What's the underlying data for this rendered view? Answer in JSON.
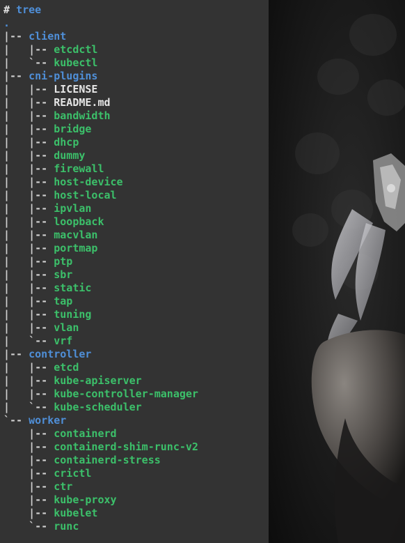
{
  "terminal": {
    "prompt_symbol": "#",
    "command": "tree",
    "root": ".",
    "lines": [
      {
        "prefix": "|-- ",
        "name": "client",
        "kind": "dir"
      },
      {
        "prefix": "|   |-- ",
        "name": "etcdctl",
        "kind": "exe"
      },
      {
        "prefix": "|   `-- ",
        "name": "kubectl",
        "kind": "exe"
      },
      {
        "prefix": "|-- ",
        "name": "cni-plugins",
        "kind": "dir"
      },
      {
        "prefix": "|   |-- ",
        "name": "LICENSE",
        "kind": "file"
      },
      {
        "prefix": "|   |-- ",
        "name": "README.md",
        "kind": "file"
      },
      {
        "prefix": "|   |-- ",
        "name": "bandwidth",
        "kind": "exe"
      },
      {
        "prefix": "|   |-- ",
        "name": "bridge",
        "kind": "exe"
      },
      {
        "prefix": "|   |-- ",
        "name": "dhcp",
        "kind": "exe"
      },
      {
        "prefix": "|   |-- ",
        "name": "dummy",
        "kind": "exe"
      },
      {
        "prefix": "|   |-- ",
        "name": "firewall",
        "kind": "exe"
      },
      {
        "prefix": "|   |-- ",
        "name": "host-device",
        "kind": "exe"
      },
      {
        "prefix": "|   |-- ",
        "name": "host-local",
        "kind": "exe"
      },
      {
        "prefix": "|   |-- ",
        "name": "ipvlan",
        "kind": "exe"
      },
      {
        "prefix": "|   |-- ",
        "name": "loopback",
        "kind": "exe"
      },
      {
        "prefix": "|   |-- ",
        "name": "macvlan",
        "kind": "exe"
      },
      {
        "prefix": "|   |-- ",
        "name": "portmap",
        "kind": "exe"
      },
      {
        "prefix": "|   |-- ",
        "name": "ptp",
        "kind": "exe"
      },
      {
        "prefix": "|   |-- ",
        "name": "sbr",
        "kind": "exe"
      },
      {
        "prefix": "|   |-- ",
        "name": "static",
        "kind": "exe"
      },
      {
        "prefix": "|   |-- ",
        "name": "tap",
        "kind": "exe"
      },
      {
        "prefix": "|   |-- ",
        "name": "tuning",
        "kind": "exe"
      },
      {
        "prefix": "|   |-- ",
        "name": "vlan",
        "kind": "exe"
      },
      {
        "prefix": "|   `-- ",
        "name": "vrf",
        "kind": "exe"
      },
      {
        "prefix": "|-- ",
        "name": "controller",
        "kind": "dir"
      },
      {
        "prefix": "|   |-- ",
        "name": "etcd",
        "kind": "exe"
      },
      {
        "prefix": "|   |-- ",
        "name": "kube-apiserver",
        "kind": "exe"
      },
      {
        "prefix": "|   |-- ",
        "name": "kube-controller-manager",
        "kind": "exe"
      },
      {
        "prefix": "|   `-- ",
        "name": "kube-scheduler",
        "kind": "exe"
      },
      {
        "prefix": "`-- ",
        "name": "worker",
        "kind": "dir"
      },
      {
        "prefix": "    |-- ",
        "name": "containerd",
        "kind": "exe"
      },
      {
        "prefix": "    |-- ",
        "name": "containerd-shim-runc-v2",
        "kind": "exe"
      },
      {
        "prefix": "    |-- ",
        "name": "containerd-stress",
        "kind": "exe"
      },
      {
        "prefix": "    |-- ",
        "name": "crictl",
        "kind": "exe"
      },
      {
        "prefix": "    |-- ",
        "name": "ctr",
        "kind": "exe"
      },
      {
        "prefix": "    |-- ",
        "name": "kube-proxy",
        "kind": "exe"
      },
      {
        "prefix": "    |-- ",
        "name": "kubelet",
        "kind": "exe"
      },
      {
        "prefix": "    `-- ",
        "name": "runc",
        "kind": "exe"
      }
    ]
  },
  "colors": {
    "terminal_bg": "#333333",
    "directory": "#4f8fd8",
    "executable": "#3cc06a",
    "plain_file": "#e6e6e6",
    "tree_lines": "#d0d0d0"
  }
}
